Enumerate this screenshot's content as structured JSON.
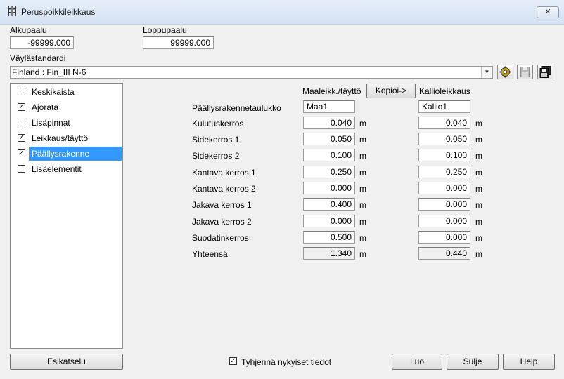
{
  "window": {
    "title": "Peruspoikkileikkaus",
    "close_label": "✕"
  },
  "header": {
    "alkupaalu_label": "Alkupaalu",
    "alkupaalu_value": "-99999.000",
    "loppupaalu_label": "Loppupaalu",
    "loppupaalu_value": "99999.000",
    "standard_label": "Väylästandardi",
    "standard_value": "Finland : Fin_III N-6"
  },
  "sidebar": {
    "items": [
      {
        "label": "Keskikaista",
        "checked": false
      },
      {
        "label": "Ajorata",
        "checked": true
      },
      {
        "label": "Lisäpinnat",
        "checked": false
      },
      {
        "label": "Leikkaus/täyttö",
        "checked": true
      },
      {
        "label": "Päällysrakenne",
        "checked": true,
        "selected": true
      },
      {
        "label": "Lisäelementit",
        "checked": false
      }
    ]
  },
  "table": {
    "col1_header": "Maaleikk./täyttö",
    "copy_button": "Kopioi->",
    "col2_header": "Kallioleikkaus",
    "table_label": "Päällysrakennetaulukko",
    "col1_table": "Maa1",
    "col2_table": "Kallio1",
    "unit": "m",
    "rows": [
      {
        "label": "Kulutuskerros",
        "v1": "0.040",
        "v2": "0.040"
      },
      {
        "label": "Sidekerros 1",
        "v1": "0.050",
        "v2": "0.050"
      },
      {
        "label": "Sidekerros 2",
        "v1": "0.100",
        "v2": "0.100"
      },
      {
        "label": "Kantava kerros 1",
        "v1": "0.250",
        "v2": "0.250"
      },
      {
        "label": "Kantava kerros 2",
        "v1": "0.000",
        "v2": "0.000"
      },
      {
        "label": "Jakava kerros 1",
        "v1": "0.400",
        "v2": "0.000"
      },
      {
        "label": "Jakava kerros 2",
        "v1": "0.000",
        "v2": "0.000"
      },
      {
        "label": "Suodatinkerros",
        "v1": "0.500",
        "v2": "0.000"
      }
    ],
    "total": {
      "label": "Yhteensä",
      "v1": "1.340",
      "v2": "0.440"
    }
  },
  "footer": {
    "preview_button": "Esikatselu",
    "clear_checkbox_label": "Tyhjennä nykyiset tiedot",
    "create_button": "Luo",
    "close_button": "Sulje",
    "help_button": "Help"
  },
  "colors": {
    "selection": "#3399ff",
    "background": "#f0f0f0"
  },
  "icons": {
    "app": "road-section-icon",
    "tool1": "gear-icon",
    "tool2": "save-icon",
    "tool3": "save-as-icon"
  }
}
